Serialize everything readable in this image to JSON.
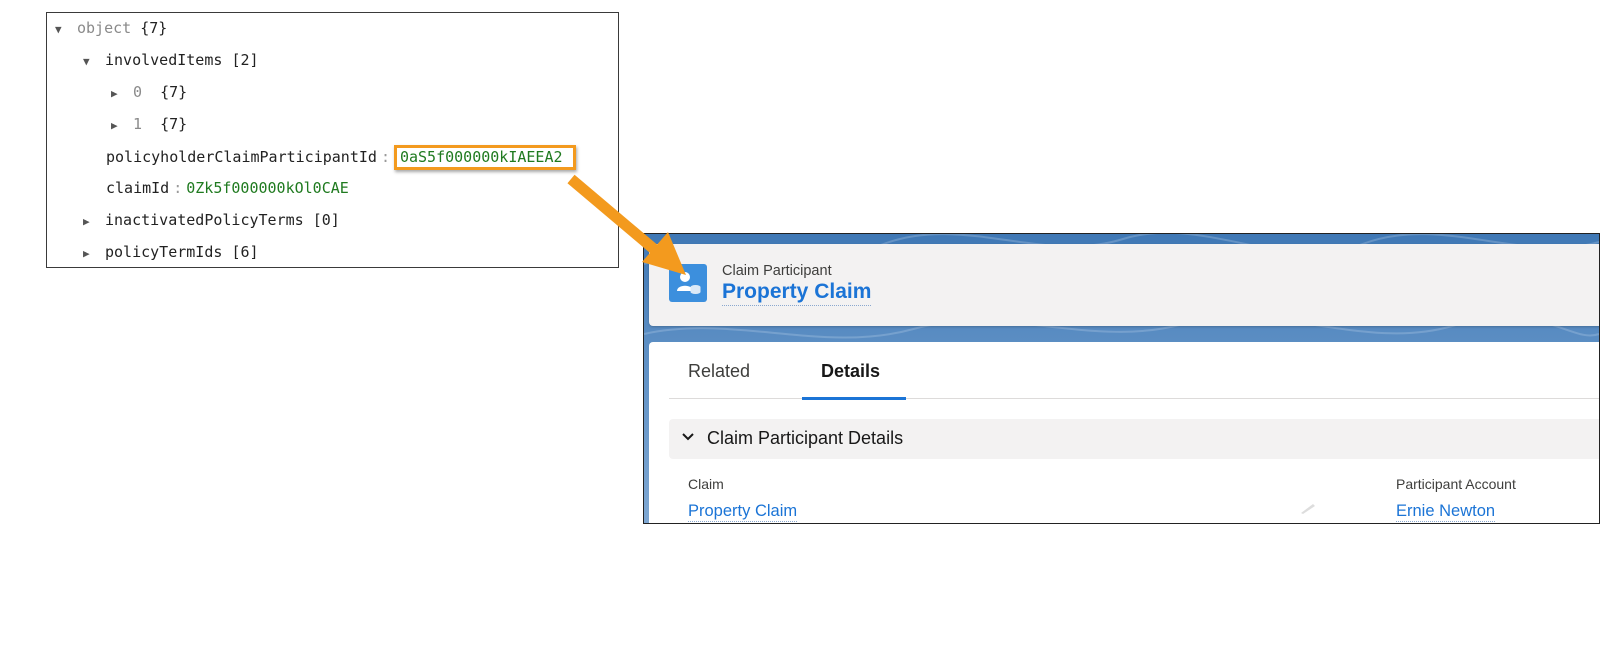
{
  "json_tree": {
    "root": {
      "name": "object",
      "count": "{7}",
      "expanded": true
    },
    "rows": [
      {
        "key": "involvedItems",
        "count": "[2]",
        "expanded": true,
        "level": 1
      },
      {
        "key": "0",
        "count": "{7}",
        "expanded": false,
        "level": 2
      },
      {
        "key": "1",
        "count": "{7}",
        "expanded": false,
        "level": 2
      },
      {
        "key": "policyholderClaimParticipantId",
        "value": "0aS5f000000kIAEEA2",
        "highlighted": true,
        "level": 2
      },
      {
        "key": "claimId",
        "value": "0Zk5f000000kOl0CAE",
        "level": 2
      },
      {
        "key": "inactivatedPolicyTerms",
        "count": "[0]",
        "expanded": false,
        "level": 1
      },
      {
        "key": "policyTermIds",
        "count": "[6]",
        "expanded": false,
        "level": 1
      }
    ],
    "separator": ":"
  },
  "annotation": {
    "highlight_color": "#f39a1e",
    "arrow_color": "#f39a1e"
  },
  "record": {
    "object_label": "Claim Participant",
    "title": "Property Claim",
    "icon": "claim-participant-icon",
    "tabs": [
      {
        "label": "Related",
        "active": false
      },
      {
        "label": "Details",
        "active": true
      }
    ],
    "section": {
      "title": "Claim Participant Details",
      "expanded": true
    },
    "fields": [
      {
        "label": "Claim",
        "value": "Property Claim"
      },
      {
        "label": "Participant Account",
        "value": "Ernie Newton"
      }
    ],
    "brand_color": "#1b74d6"
  }
}
